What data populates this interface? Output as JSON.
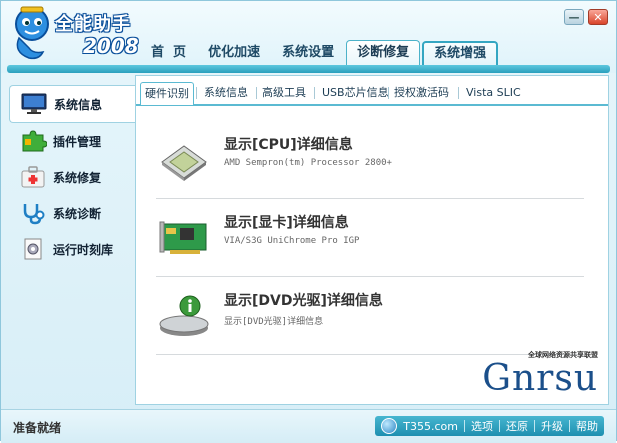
{
  "app": {
    "title": "全能助手",
    "year": "2008"
  },
  "nav": {
    "items": [
      {
        "label": "首  页"
      },
      {
        "label": "优化加速"
      },
      {
        "label": "系统设置"
      },
      {
        "label": "诊断修复"
      },
      {
        "label": "系统增强"
      }
    ],
    "active_index": 3
  },
  "sidebar": {
    "items": [
      {
        "label": "系统信息",
        "icon": "monitor-icon"
      },
      {
        "label": "插件管理",
        "icon": "puzzle-icon"
      },
      {
        "label": "系统修复",
        "icon": "first-aid-kit-icon"
      },
      {
        "label": "系统诊断",
        "icon": "stethoscope-icon"
      },
      {
        "label": "运行时刻库",
        "icon": "gear-document-icon"
      }
    ],
    "active_index": 0
  },
  "subtabs": {
    "items": [
      {
        "label": "硬件识别"
      },
      {
        "label": "系统信息"
      },
      {
        "label": "高级工具"
      },
      {
        "label": "USB芯片信息"
      },
      {
        "label": "授权激活码"
      },
      {
        "label": "Vista SLIC"
      }
    ],
    "active_index": 0
  },
  "hardware": [
    {
      "title": "显示[CPU]详细信息",
      "detail": "AMD Sempron(tm) Processor 2800+",
      "icon": "cpu-chip-icon"
    },
    {
      "title": "显示[显卡]详细信息",
      "detail": "VIA/S3G UniChrome Pro IGP",
      "icon": "graphics-card-icon"
    },
    {
      "title": "显示[DVD光驱]详细信息",
      "detail": "显示[DVD光驱]详细信息",
      "icon": "dvd-drive-icon"
    }
  ],
  "watermark": {
    "top": "全球网络资源共享联盟",
    "text": "Gnrsu"
  },
  "statusbar": {
    "text": "准备就绪",
    "links": {
      "site": "T355.com",
      "options": "选项",
      "restore": "还原",
      "upgrade": "升级",
      "help": "帮助"
    }
  },
  "colors": {
    "accent": "#2aa0bd",
    "nav_text": "#1f4a66",
    "brand_blue": "#0a4f9b"
  }
}
